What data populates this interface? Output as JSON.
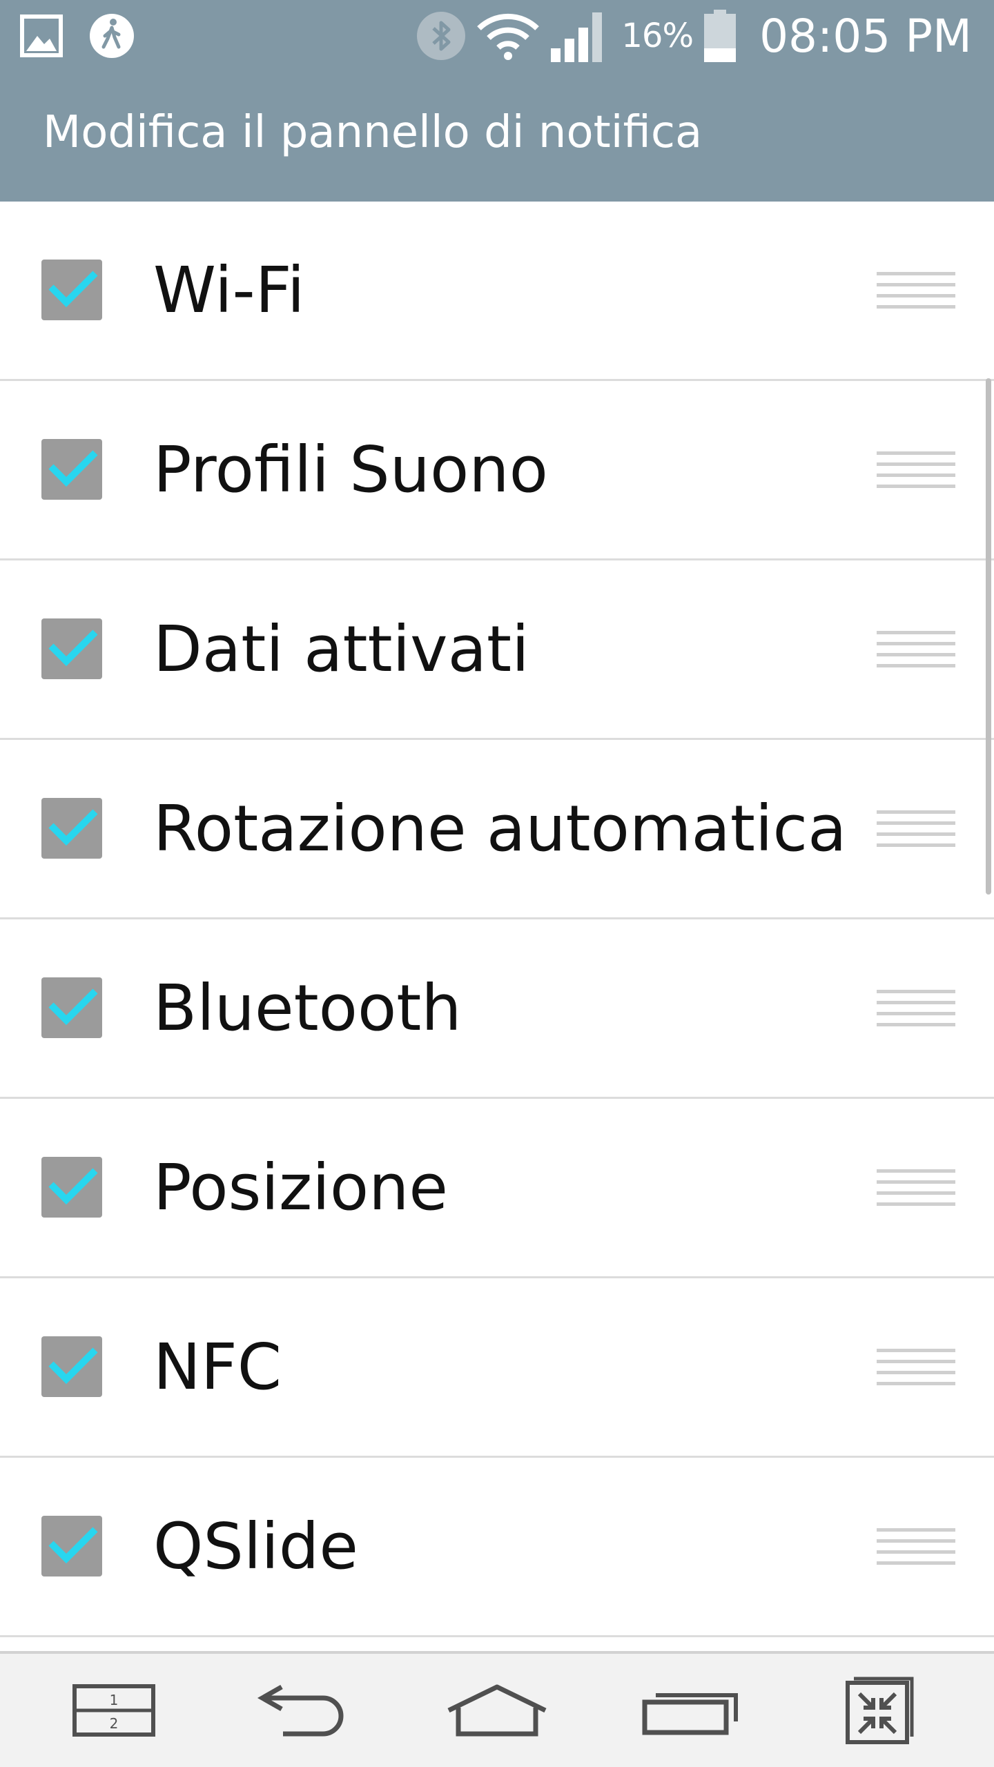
{
  "status_bar": {
    "battery_percent": "16%",
    "time": "08:05 PM",
    "left_icons": [
      "gallery-icon",
      "pedometer-icon"
    ],
    "right_icons": [
      "bluetooth-icon",
      "wifi-icon",
      "signal-icon",
      "battery-icon"
    ]
  },
  "header": {
    "title": "Modifica il pannello di notifica"
  },
  "list": {
    "items": [
      {
        "label": "Wi-Fi",
        "checked": true
      },
      {
        "label": "Profili Suono",
        "checked": true
      },
      {
        "label": "Dati attivati",
        "checked": true
      },
      {
        "label": "Rotazione automatica",
        "checked": true
      },
      {
        "label": "Bluetooth",
        "checked": true
      },
      {
        "label": "Posizione",
        "checked": true
      },
      {
        "label": "NFC",
        "checked": true
      },
      {
        "label": "QSlide",
        "checked": true
      }
    ]
  },
  "nav_bar": {
    "dual_window_top": "1",
    "dual_window_bottom": "2",
    "icons": [
      "dual-window-icon",
      "back-icon",
      "home-icon",
      "recent-apps-icon",
      "mini-view-icon"
    ]
  },
  "colors": {
    "header_bg": "#8198a5",
    "check_accent": "#28d6ef",
    "checkbox_bg": "#9b9b9b",
    "divider": "#dcdcdc"
  }
}
